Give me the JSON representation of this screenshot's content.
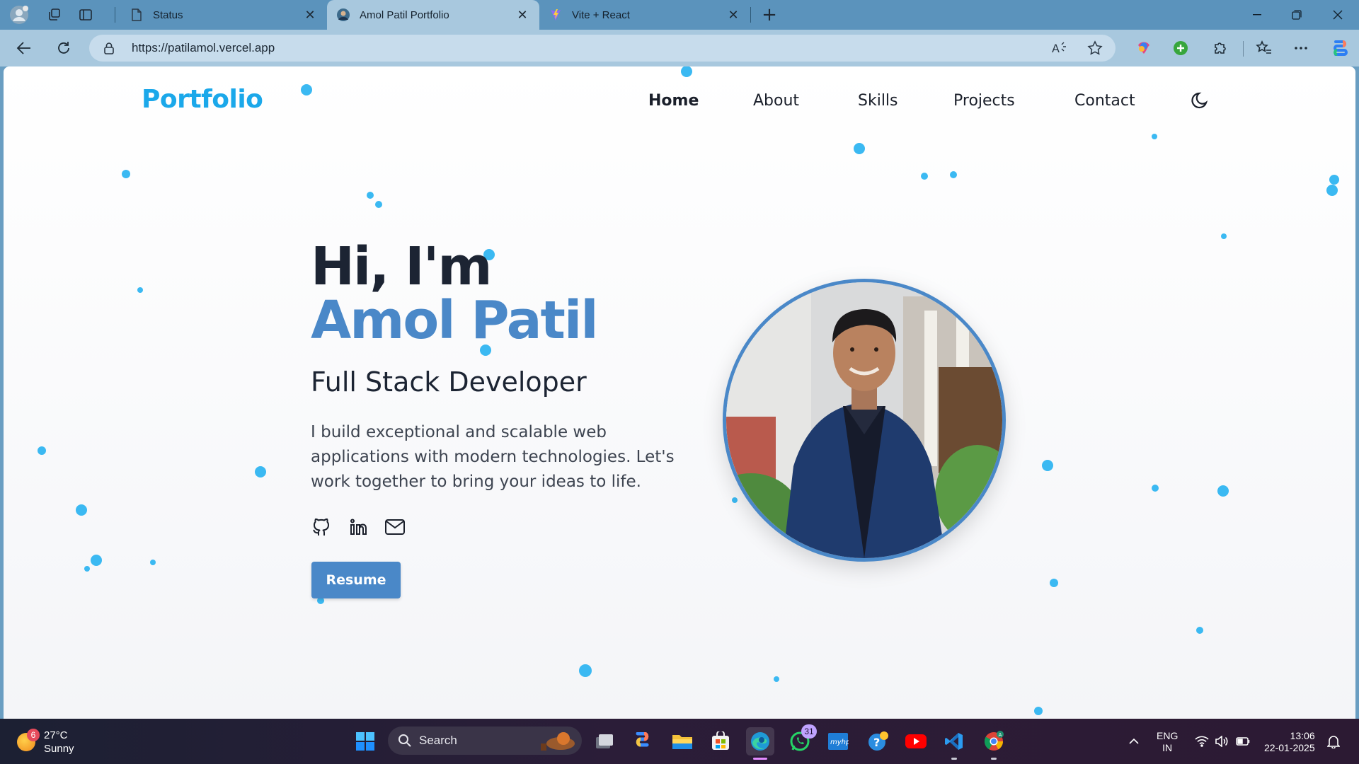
{
  "browser": {
    "tabs": [
      {
        "title": "Status",
        "active": false
      },
      {
        "title": "Amol Patil Portfolio",
        "active": true
      },
      {
        "title": "Vite + React",
        "active": false
      }
    ],
    "url": "https://patilamol.vercel.app"
  },
  "page": {
    "logo": "Portfolio",
    "nav": [
      "Home",
      "About",
      "Skills",
      "Projects",
      "Contact"
    ],
    "hero": {
      "greeting": "Hi, I'm",
      "name": "Amol Patil",
      "role": "Full Stack Developer",
      "description": "I build exceptional and scalable web applications with modern technologies. Let's work together to bring your ideas to life.",
      "resume_button": "Resume",
      "socials": [
        "github-icon",
        "linkedin-icon",
        "mail-icon"
      ]
    },
    "colors": {
      "accent": "#4a88c8",
      "logo": "#1ba8ea",
      "particles": "#3bb9f2"
    }
  },
  "taskbar": {
    "weather": {
      "badge": "6",
      "temp": "27°C",
      "condition": "Sunny"
    },
    "search_label": "Search",
    "whatsapp_badge": "31",
    "language": {
      "line1": "ENG",
      "line2": "IN"
    },
    "clock": {
      "time": "13:06",
      "date": "22-01-2025"
    }
  }
}
